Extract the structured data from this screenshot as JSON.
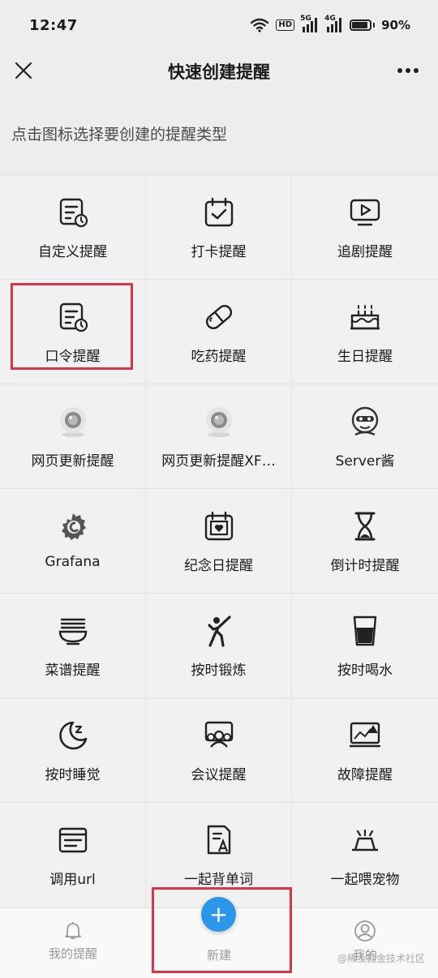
{
  "status_bar": {
    "time": "12:47",
    "hd_badge": "HD",
    "net1": "5G",
    "net2": "4G",
    "battery": "90%",
    "battery_level": 0.9
  },
  "nav": {
    "title": "快速创建提醒"
  },
  "hint": "点击图标选择要创建的提醒类型",
  "grid": [
    {
      "label": "自定义提醒",
      "icon": "calendar-clock-icon"
    },
    {
      "label": "打卡提醒",
      "icon": "calendar-check-icon"
    },
    {
      "label": "追剧提醒",
      "icon": "tv-play-icon"
    },
    {
      "label": "口令提醒",
      "icon": "calendar-clock-icon"
    },
    {
      "label": "吃药提醒",
      "icon": "pill-icon"
    },
    {
      "label": "生日提醒",
      "icon": "birthday-cake-icon"
    },
    {
      "label": "网页更新提醒",
      "icon": "webcam-icon"
    },
    {
      "label": "网页更新提醒XF…",
      "icon": "webcam-icon"
    },
    {
      "label": "Server酱",
      "icon": "server-avatar-icon"
    },
    {
      "label": "Grafana",
      "icon": "grafana-logo-icon"
    },
    {
      "label": "纪念日提醒",
      "icon": "calendar-heart-icon"
    },
    {
      "label": "倒计时提醒",
      "icon": "hourglass-icon"
    },
    {
      "label": "菜谱提醒",
      "icon": "noodle-bowl-icon"
    },
    {
      "label": "按时锻炼",
      "icon": "exercise-person-icon"
    },
    {
      "label": "按时喝水",
      "icon": "water-glass-icon"
    },
    {
      "label": "按时睡觉",
      "icon": "moon-sleep-icon"
    },
    {
      "label": "会议提醒",
      "icon": "meeting-people-icon"
    },
    {
      "label": "故障提醒",
      "icon": "monitor-alert-icon"
    },
    {
      "label": "调用url",
      "icon": "browser-window-icon"
    },
    {
      "label": "一起背单词",
      "icon": "document-letter-icon"
    },
    {
      "label": "一起喂宠物",
      "icon": "pet-bowl-icon"
    }
  ],
  "tabs": {
    "my_reminders": "我的提醒",
    "create": "新建",
    "create_symbol": "+",
    "me": "我的"
  },
  "watermark": "@稀土掘金技术社区",
  "colors": {
    "accent": "#2c97e8",
    "highlight": "#d9344a"
  }
}
